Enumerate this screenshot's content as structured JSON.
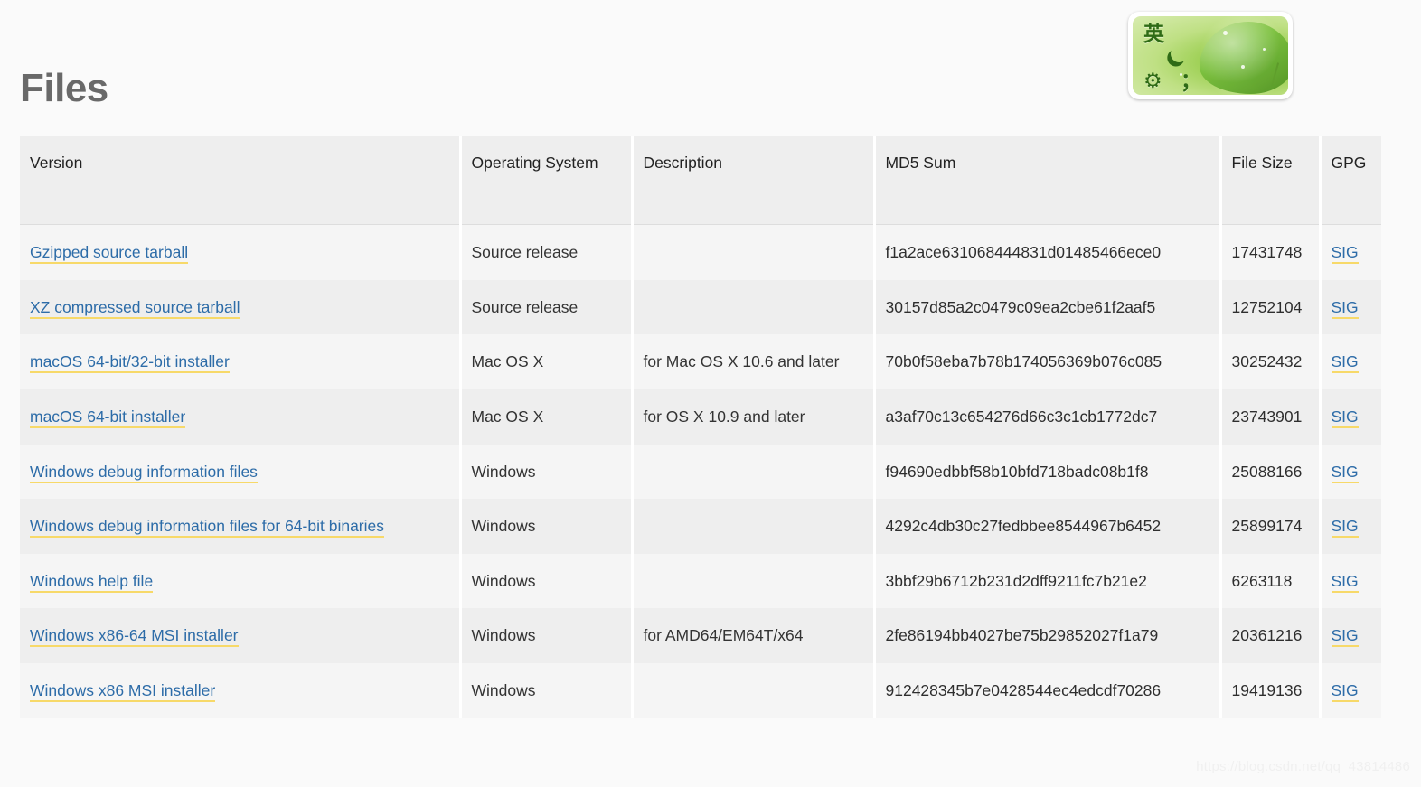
{
  "page": {
    "title": "Files",
    "watermark": "https://blog.csdn.net/qq_43814486",
    "accent_link_color": "#2d6ca8",
    "link_underline_color": "#f7d969",
    "header_row_color": "#eeeeee",
    "row_odd_color": "#f5f5f5",
    "row_even_color": "#eeeeee",
    "page_background": "#fafafa",
    "title_color": "#696969"
  },
  "ime_bar": {
    "language_indicator": "英",
    "moon_icon": "crescent-moon",
    "gear_icon": "⚙",
    "punctuation_toggle": "；"
  },
  "table": {
    "columns": [
      {
        "key": "version",
        "label": "Version"
      },
      {
        "key": "os",
        "label": "Operating System"
      },
      {
        "key": "description",
        "label": "Description"
      },
      {
        "key": "md5",
        "label": "MD5 Sum"
      },
      {
        "key": "size",
        "label": "File Size"
      },
      {
        "key": "gpg",
        "label": "GPG"
      }
    ],
    "rows": [
      {
        "version": "Gzipped source tarball",
        "os": "Source release",
        "description": "",
        "md5": "f1a2ace631068444831d01485466ece0",
        "size": "17431748",
        "gpg": "SIG"
      },
      {
        "version": "XZ compressed source tarball",
        "os": "Source release",
        "description": "",
        "md5": "30157d85a2c0479c09ea2cbe61f2aaf5",
        "size": "12752104",
        "gpg": "SIG"
      },
      {
        "version": "macOS 64-bit/32-bit installer",
        "os": "Mac OS X",
        "description": "for Mac OS X 10.6 and later",
        "md5": "70b0f58eba7b78b174056369b076c085",
        "size": "30252432",
        "gpg": "SIG"
      },
      {
        "version": "macOS 64-bit installer",
        "os": "Mac OS X",
        "description": "for OS X 10.9 and later",
        "md5": "a3af70c13c654276d66c3c1cb1772dc7",
        "size": "23743901",
        "gpg": "SIG"
      },
      {
        "version": "Windows debug information files",
        "os": "Windows",
        "description": "",
        "md5": "f94690edbbf58b10bfd718badc08b1f8",
        "size": "25088166",
        "gpg": "SIG"
      },
      {
        "version": "Windows debug information files for 64-bit binaries",
        "os": "Windows",
        "description": "",
        "md5": "4292c4db30c27fedbbee8544967b6452",
        "size": "25899174",
        "gpg": "SIG"
      },
      {
        "version": "Windows help file",
        "os": "Windows",
        "description": "",
        "md5": "3bbf29b6712b231d2dff9211fc7b21e2",
        "size": "6263118",
        "gpg": "SIG"
      },
      {
        "version": "Windows x86-64 MSI installer",
        "os": "Windows",
        "description": "for AMD64/EM64T/x64",
        "md5": "2fe86194bb4027be75b29852027f1a79",
        "size": "20361216",
        "gpg": "SIG"
      },
      {
        "version": "Windows x86 MSI installer",
        "os": "Windows",
        "description": "",
        "md5": "912428345b7e0428544ec4edcdf70286",
        "size": "19419136",
        "gpg": "SIG"
      }
    ]
  }
}
